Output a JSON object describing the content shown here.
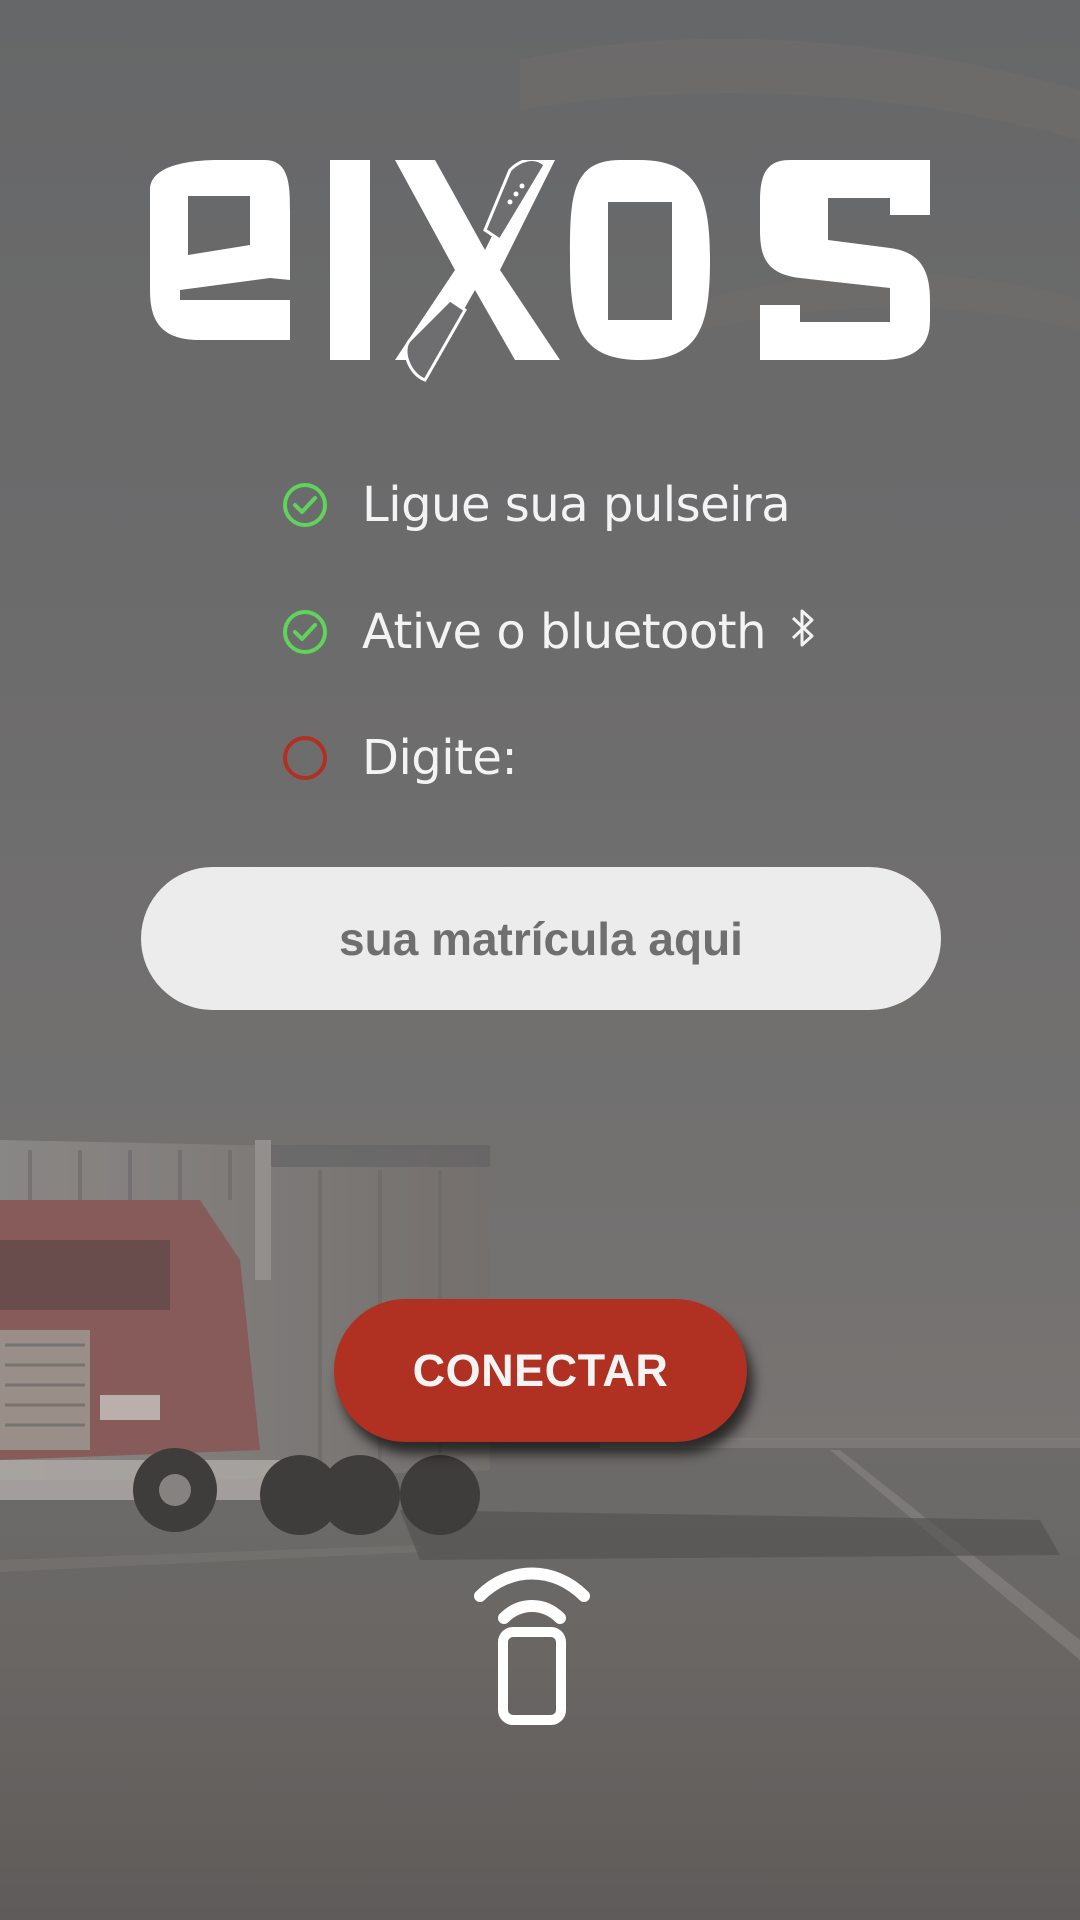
{
  "brand": {
    "logo_text": "eixos"
  },
  "steps": [
    {
      "label": "Ligue sua pulseira",
      "status": "done",
      "icon": "check-circle-icon",
      "color": "#5fd35a"
    },
    {
      "label": "Ative o bluetooth",
      "status": "done",
      "icon": "check-circle-icon",
      "color": "#5fd35a",
      "extra_icon": "bluetooth-icon"
    },
    {
      "label": "Digite:",
      "status": "pending",
      "icon": "empty-circle-icon",
      "color": "#b03022"
    }
  ],
  "registration_input": {
    "placeholder": "sua matrícula aqui",
    "value": ""
  },
  "connect_button": {
    "label": "CONECTAR",
    "color": "#b03022"
  },
  "footer_icon": "phone-wireless-icon",
  "background": {
    "description_icon": "truck-on-road-photo"
  }
}
